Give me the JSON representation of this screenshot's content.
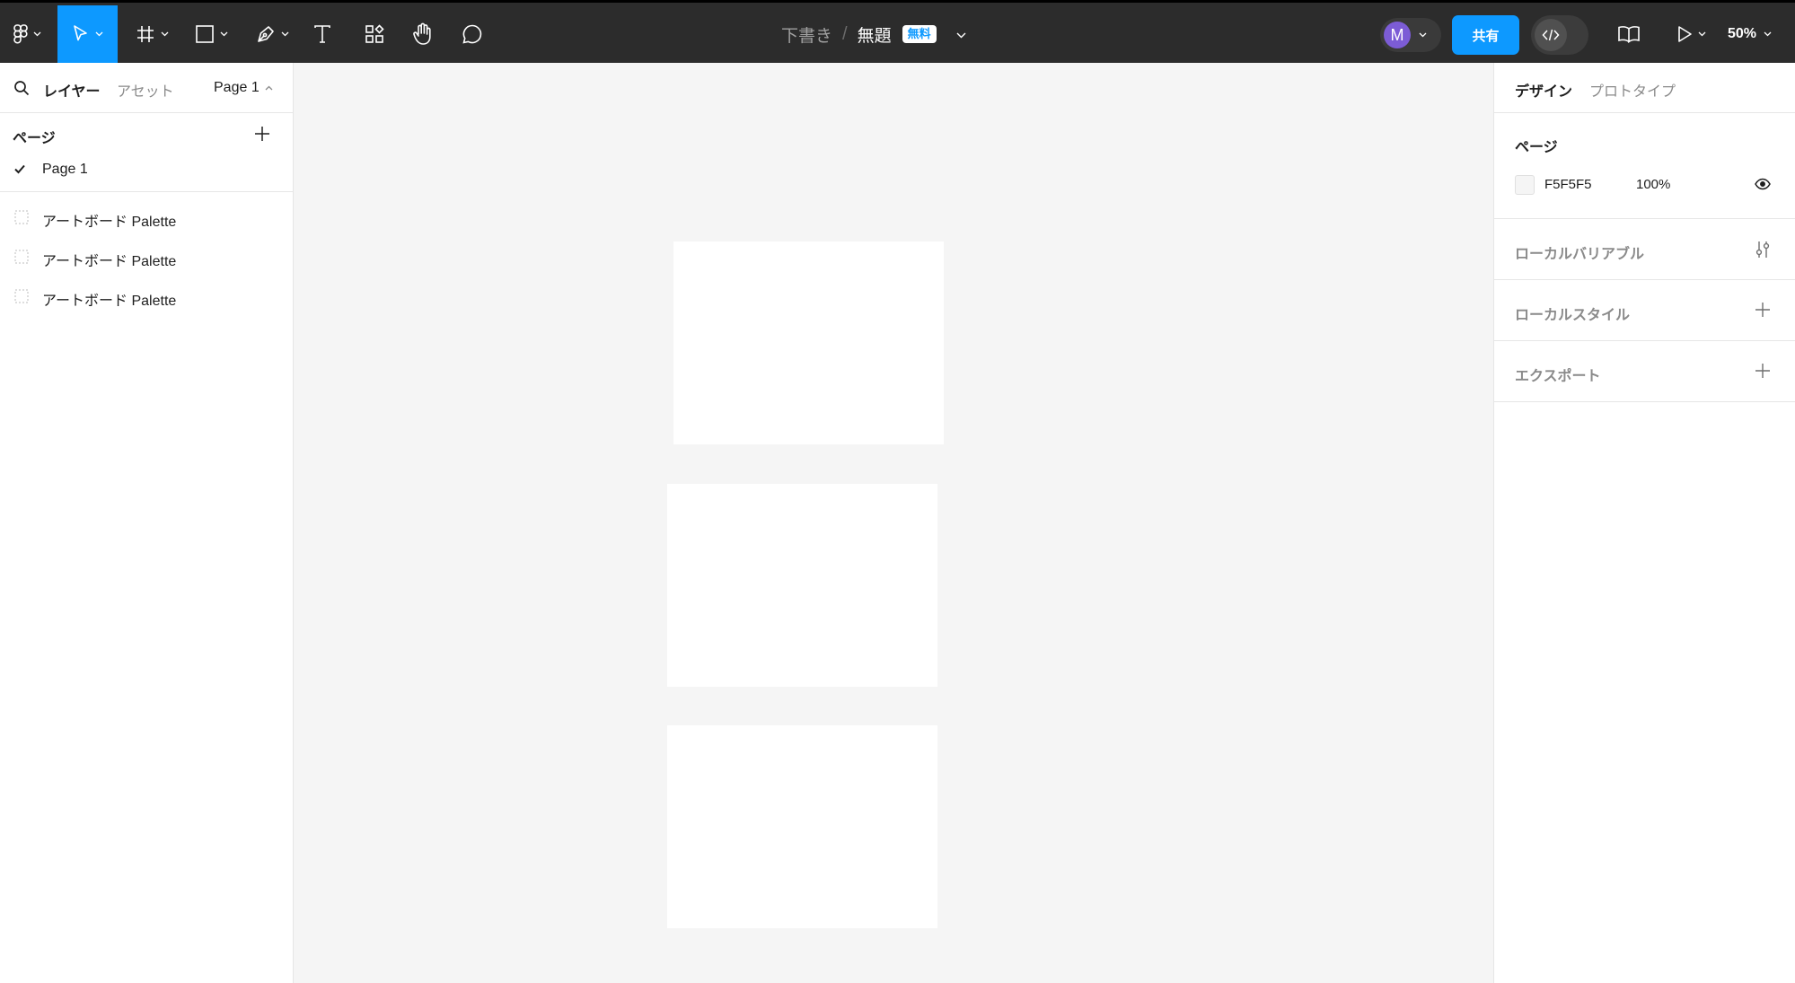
{
  "toolbar": {
    "file_draft": "下書き",
    "file_separator": "/",
    "file_title": "無題",
    "plan_badge": "無料",
    "avatar_initial": "M",
    "share_label": "共有",
    "zoom_label": "50%",
    "accent_color": "#0d99ff",
    "icons": [
      "figma-menu-icon",
      "move-tool-icon",
      "frame-tool-icon",
      "rectangle-tool-icon",
      "pen-tool-icon",
      "text-tool-icon",
      "resources-icon",
      "hand-tool-icon",
      "comment-icon",
      "dev-mode-icon",
      "library-book-icon",
      "present-play-icon"
    ]
  },
  "left_panel": {
    "tab_layers": "レイヤー",
    "tab_assets": "アセット",
    "current_page": "Page 1",
    "pages_title": "ページ",
    "pages": [
      {
        "label": "Page 1",
        "selected": true
      }
    ],
    "layers": [
      {
        "label": "アートボード Palette"
      },
      {
        "label": "アートボード Palette"
      },
      {
        "label": "アートボード Palette"
      }
    ]
  },
  "canvas": {
    "background": "#F5F5F5",
    "artboard_color": "#FFFFFF",
    "artboard_count": 3
  },
  "right_panel": {
    "tab_design": "デザイン",
    "tab_prototype": "プロトタイプ",
    "page_section_title": "ページ",
    "page_color_hex": "F5F5F5",
    "page_color_opacity": "100%",
    "local_variables": "ローカルバリアブル",
    "local_styles": "ローカルスタイル",
    "export": "エクスポート"
  }
}
